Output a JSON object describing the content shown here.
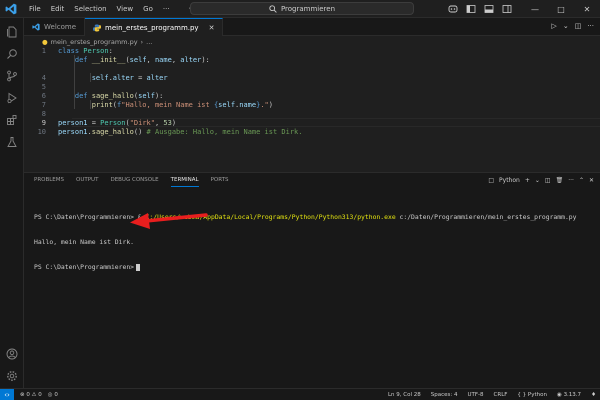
{
  "titlebar": {
    "menu": [
      "File",
      "Edit",
      "Selection",
      "View",
      "Go",
      "···"
    ],
    "search_text": "Programmieren"
  },
  "tabs": [
    {
      "label": "Welcome",
      "active": false
    },
    {
      "label": "mein_erstes_programm.py",
      "active": true
    }
  ],
  "breadcrumb": {
    "file": "mein_erstes_programm.py",
    "rest": "..."
  },
  "editor": {
    "lines": [
      1,
      4,
      5,
      6,
      7,
      8,
      9,
      10
    ]
  },
  "panel": {
    "tabs": [
      "PROBLEMS",
      "OUTPUT",
      "DEBUG CONSOLE",
      "TERMINAL",
      "PORTS"
    ],
    "active_tab": "TERMINAL",
    "shell_label": "Python",
    "terminal": {
      "line1_prompt": "PS C:\\Daten\\Programmieren> & ",
      "line1_exe": "C:/Users/webma/AppData/Local/Programs/Python/Python313/python.exe",
      "line1_arg": " c:/Daten/Programmieren/mein_erstes_programm.py",
      "line2": "Hallo, mein Name ist Dirk.",
      "line3": "PS C:\\Daten\\Programmieren>"
    }
  },
  "statusbar": {
    "errors": "0",
    "warnings": "0",
    "ports": "0",
    "position": "Ln 9, Col 28",
    "spaces": "Spaces: 4",
    "encoding": "UTF-8",
    "eol": "CRLF",
    "language": "Python",
    "version": "3.13.7"
  },
  "colors": {
    "accent": "#0078d4",
    "arrow": "#e81e1e"
  }
}
